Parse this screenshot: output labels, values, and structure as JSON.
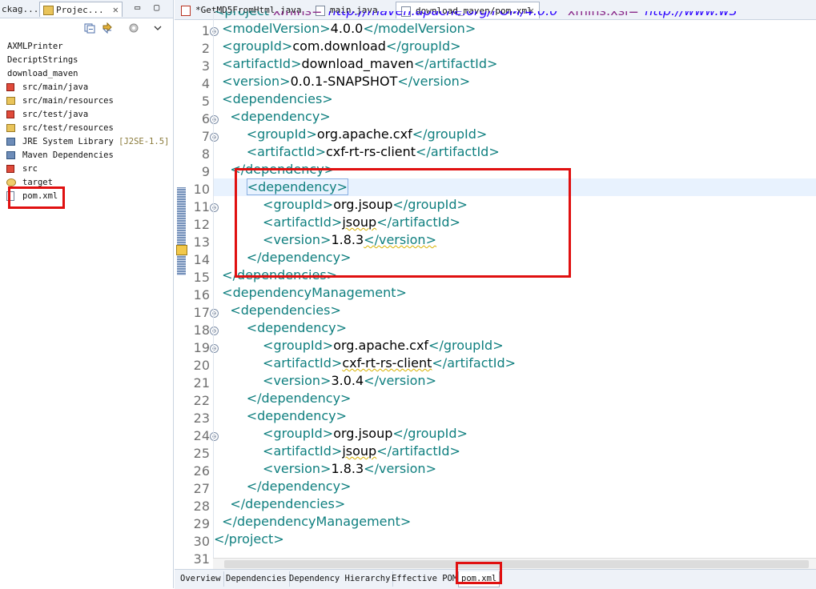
{
  "left_panel": {
    "tabs": [
      {
        "label": "ckag..."
      },
      {
        "label": "Projec...",
        "close": "✕"
      }
    ],
    "window_controls": {
      "minimize": "▭",
      "maximize": "▢"
    },
    "toolbar": {
      "collapse_icon": "collapse-all-icon",
      "link_icon": "link-with-editor-icon",
      "menu_icon": "view-menu-icon"
    },
    "tree": [
      {
        "label": "AXMLPrinter",
        "icon": "none",
        "indent": false
      },
      {
        "label": "DecriptStrings",
        "icon": "none",
        "indent": false
      },
      {
        "label": "download_maven",
        "icon": "none",
        "indent": false
      },
      {
        "label": "src/main/java",
        "icon": "err",
        "indent": true
      },
      {
        "label": "src/main/resources",
        "icon": "pkg",
        "indent": true
      },
      {
        "label": "src/test/java",
        "icon": "err",
        "indent": true
      },
      {
        "label": "src/test/resources",
        "icon": "pkg",
        "indent": true
      },
      {
        "label": "JRE System Library",
        "decor": "[J2SE-1.5]",
        "icon": "lib",
        "indent": true
      },
      {
        "label": "Maven Dependencies",
        "icon": "lib",
        "indent": true
      },
      {
        "label": "src",
        "icon": "err",
        "indent": true
      },
      {
        "label": "target",
        "icon": "fold",
        "indent": true
      },
      {
        "label": "pom.xml",
        "icon": "file",
        "indent": true
      }
    ]
  },
  "editor": {
    "tabs": [
      {
        "label": "*GetMD5FromHtml.java",
        "active": false
      },
      {
        "label": "main.java",
        "active": false
      },
      {
        "label": "download_maven/pom.xml",
        "active": true,
        "close": "✕"
      }
    ],
    "first_line_partial": "<project xmlns=\"http://maven.apache.org/POM/4.0.0\" xmlns:xsi=\"http://www.w3",
    "lines": [
      {
        "n": "1",
        "fold": "⊖"
      },
      {
        "n": "2",
        "indent": 1,
        "tag": "modelVersion",
        "text": "4.0.0"
      },
      {
        "n": "3",
        "indent": 1,
        "tag": "groupId",
        "text": "com.download"
      },
      {
        "n": "4",
        "indent": 1,
        "tag": "artifactId",
        "text": "download_maven"
      },
      {
        "n": "5",
        "indent": 1,
        "tag": "version",
        "text": "0.0.1-SNAPSHOT"
      },
      {
        "n": "6",
        "indent": 1,
        "open": "dependencies",
        "fold": "⊖"
      },
      {
        "n": "7",
        "indent": 2,
        "open": "dependency",
        "fold": "⊖"
      },
      {
        "n": "8",
        "indent": 4,
        "tag": "groupId",
        "text": "org.apache.cxf"
      },
      {
        "n": "9",
        "indent": 4,
        "tag": "artifactId",
        "text": "cxf-rt-rs-client"
      },
      {
        "n": "10",
        "indent": 2,
        "close": "dependency"
      },
      {
        "n": "11",
        "indent": 4,
        "open": "dependency",
        "fold": "⊖",
        "current": true
      },
      {
        "n": "12",
        "indent": 6,
        "tag": "groupId",
        "text": "org.jsoup"
      },
      {
        "n": "13",
        "indent": 6,
        "tag": "artifactId",
        "text": "jsoup"
      },
      {
        "n": "14",
        "indent": 6,
        "tag": "version",
        "text": "1.8.3"
      },
      {
        "n": "15",
        "indent": 4,
        "close": "dependency"
      },
      {
        "n": "16",
        "indent": 1,
        "close": "dependencies"
      },
      {
        "n": "17",
        "indent": 1,
        "open": "dependencyManagement",
        "fold": "⊖"
      },
      {
        "n": "18",
        "indent": 2,
        "open": "dependencies",
        "fold": "⊖"
      },
      {
        "n": "19",
        "indent": 4,
        "open": "dependency",
        "fold": "⊖"
      },
      {
        "n": "20",
        "indent": 6,
        "tag": "groupId",
        "text": "org.apache.cxf"
      },
      {
        "n": "21",
        "indent": 6,
        "tag": "artifactId",
        "text": "cxf-rt-rs-client"
      },
      {
        "n": "22",
        "indent": 6,
        "tag": "version",
        "text": "3.0.4"
      },
      {
        "n": "23",
        "indent": 4,
        "close": "dependency"
      },
      {
        "n": "24",
        "indent": 4,
        "open": "dependency",
        "fold": "⊖"
      },
      {
        "n": "25",
        "indent": 6,
        "tag": "groupId",
        "text": "org.jsoup"
      },
      {
        "n": "26",
        "indent": 6,
        "tag": "artifactId",
        "text": "jsoup"
      },
      {
        "n": "27",
        "indent": 6,
        "tag": "version",
        "text": "1.8.3"
      },
      {
        "n": "28",
        "indent": 4,
        "close": "dependency"
      },
      {
        "n": "29",
        "indent": 2,
        "close": "dependencies"
      },
      {
        "n": "30",
        "indent": 1,
        "close": "dependencyManagement"
      },
      {
        "n": "31",
        "indent": 0,
        "close": "project"
      }
    ],
    "bottom_tabs": [
      {
        "label": "Overview"
      },
      {
        "label": "Dependencies"
      },
      {
        "label": "Dependency Hierarchy"
      },
      {
        "label": "Effective POM"
      },
      {
        "label": "pom.xml",
        "active": true
      }
    ]
  }
}
